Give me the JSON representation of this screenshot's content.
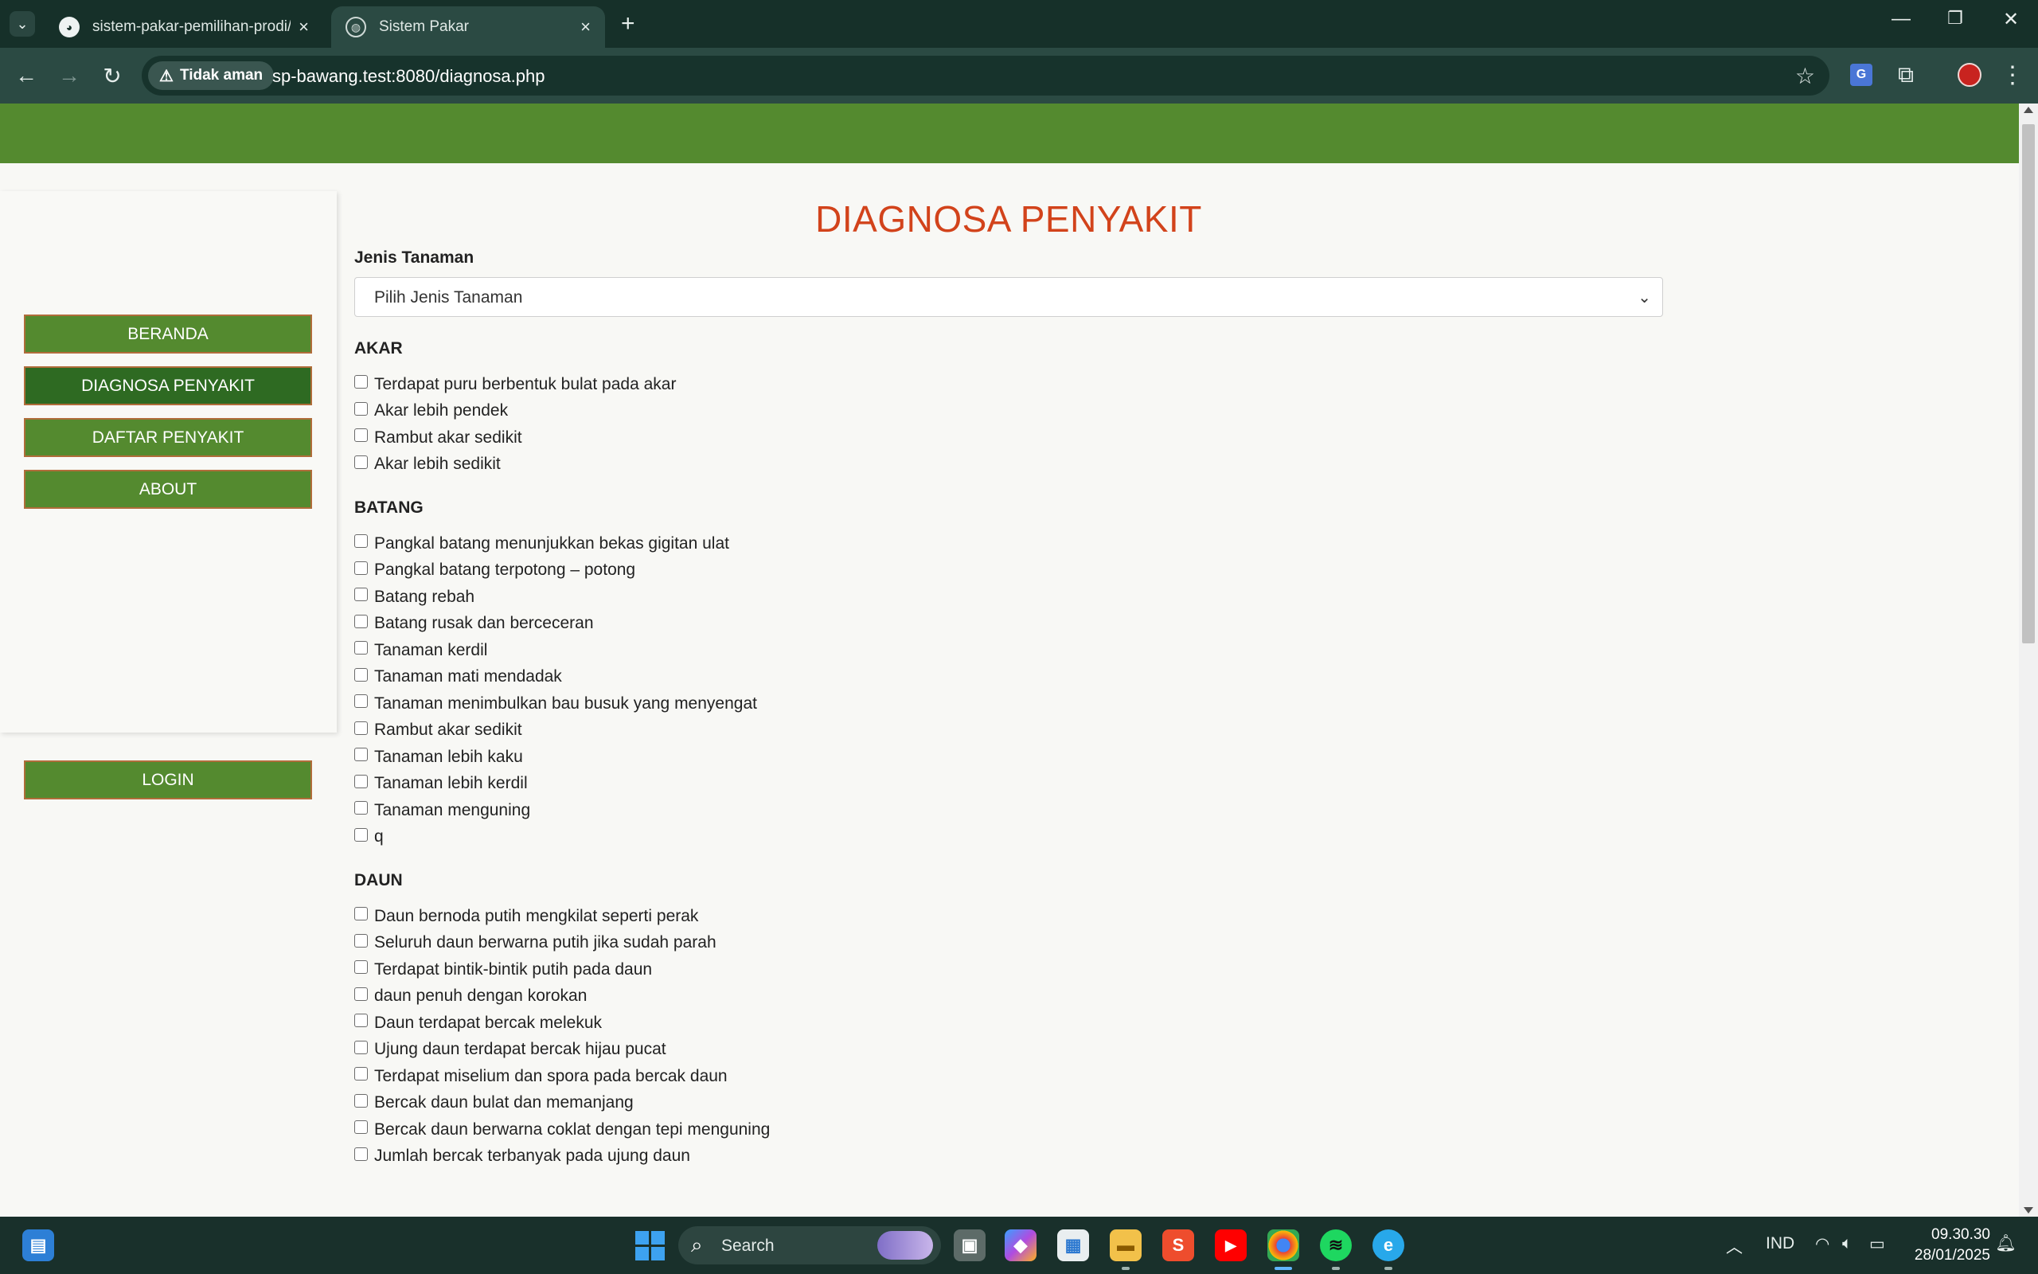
{
  "browser": {
    "tabs": [
      {
        "title": "sistem-pakar-pemilihan-prodi/",
        "favicon": "github-icon",
        "active": false
      },
      {
        "title": "Sistem Pakar",
        "favicon": "globe-icon",
        "active": true
      }
    ],
    "security_label": "Tidak aman",
    "url": "sp-bawang.test:8080/diagnosa.php"
  },
  "sidebar": {
    "items": [
      {
        "label": "BERANDA",
        "active": false
      },
      {
        "label": "DIAGNOSA PENYAKIT",
        "active": true
      },
      {
        "label": "DAFTAR PENYAKIT",
        "active": false
      },
      {
        "label": "ABOUT",
        "active": false
      }
    ],
    "login_label": "LOGIN"
  },
  "main": {
    "title": "DIAGNOSA PENYAKIT",
    "plant_label": "Jenis Tanaman",
    "plant_select_value": "Pilih Jenis Tanaman",
    "groups": [
      {
        "title": "AKAR",
        "symptoms": [
          "Terdapat puru berbentuk bulat pada akar",
          "Akar lebih pendek",
          "Rambut akar sedikit",
          "Akar lebih sedikit"
        ]
      },
      {
        "title": "BATANG",
        "symptoms": [
          "Pangkal batang menunjukkan bekas gigitan ulat",
          "Pangkal batang terpotong – potong",
          "Batang rebah",
          "Batang rusak dan berceceran",
          "Tanaman kerdil",
          "Tanaman mati mendadak",
          "Tanaman menimbulkan bau busuk yang menyengat",
          "Rambut akar sedikit",
          "Tanaman lebih kaku",
          "Tanaman lebih kerdil",
          "Tanaman menguning",
          "q"
        ]
      },
      {
        "title": "DAUN",
        "symptoms": [
          "Daun bernoda putih mengkilat seperti perak",
          "Seluruh daun berwarna putih jika sudah parah",
          "Terdapat bintik-bintik putih pada daun",
          "daun penuh dengan korokan",
          "Daun terdapat bercak melekuk",
          "Ujung daun terdapat bercak hijau pucat",
          "Terdapat miselium dan spora pada bercak daun",
          "Bercak daun bulat dan memanjang",
          "Bercak daun berwarna coklat dengan tepi menguning",
          "Jumlah bercak terbanyak pada ujung daun"
        ]
      }
    ]
  },
  "taskbar": {
    "search_placeholder": "Search",
    "language": "IND",
    "time": "09.30.30",
    "date": "28/01/2025"
  },
  "colors": {
    "banner": "#548a2f",
    "menu_button": "#548a2f",
    "menu_button_active": "#2e6a22",
    "menu_border": "#b06d3a",
    "title": "#d2431b"
  }
}
